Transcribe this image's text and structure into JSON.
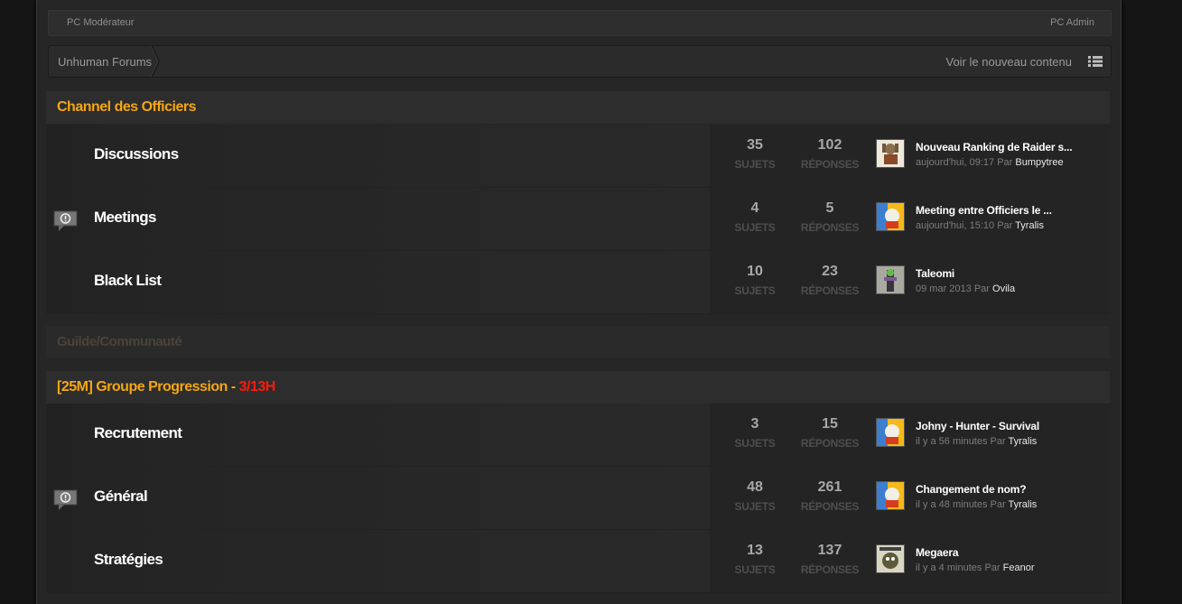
{
  "topbar": {
    "left": "PC Modérateur",
    "right": "PC Admin"
  },
  "breadcrumb": {
    "home": "Unhuman Forums",
    "new_content": "Voir le nouveau contenu"
  },
  "categories": [
    {
      "title": "Channel des Officiers"
    },
    {
      "title": "Guilde/Communauté"
    },
    {
      "title_prefix": "[25M] Groupe Progression - ",
      "title_suffix": "3/13H"
    }
  ],
  "labels": {
    "topics": "SUJETS",
    "replies": "RÉPONSES",
    "by": "Par"
  },
  "forums": [
    {
      "name": "Discussions",
      "topics": "35",
      "replies": "102",
      "last_title": "Nouveau Ranking de Raider s...",
      "last_date": "aujourd'hui, 09:17",
      "last_user": "Bumpytree",
      "has_alert": false,
      "avatar": "chest-avatar"
    },
    {
      "name": "Meetings",
      "topics": "4",
      "replies": "5",
      "last_title": "Meeting entre Officiers le ...",
      "last_date": "aujourd'hui, 15:10",
      "last_user": "Tyralis",
      "has_alert": true,
      "avatar": "cartoon-avatar"
    },
    {
      "name": "Black List",
      "topics": "10",
      "replies": "23",
      "last_title": "Taleomi",
      "last_date": "09 mar 2013",
      "last_user": "Ovila",
      "has_alert": false,
      "avatar": "warrior-avatar"
    },
    {
      "name": "Recrutement",
      "topics": "3",
      "replies": "15",
      "last_title": "Johny - Hunter - Survival",
      "last_date": "il y a 56 minutes",
      "last_user": "Tyralis",
      "has_alert": false,
      "avatar": "cartoon-avatar"
    },
    {
      "name": "Général",
      "topics": "48",
      "replies": "261",
      "last_title": "Changement de nom?",
      "last_date": "il y a 48 minutes",
      "last_user": "Tyralis",
      "has_alert": true,
      "avatar": "cartoon-avatar"
    },
    {
      "name": "Stratégies",
      "topics": "13",
      "replies": "137",
      "last_title": "Megaera",
      "last_date": "il y a 4 minutes",
      "last_user": "Feanor",
      "has_alert": false,
      "avatar": "creature-avatar"
    }
  ],
  "colors": {
    "accent": "#f5a614",
    "progress_red": "#ff1a0a",
    "background": "#262626"
  }
}
